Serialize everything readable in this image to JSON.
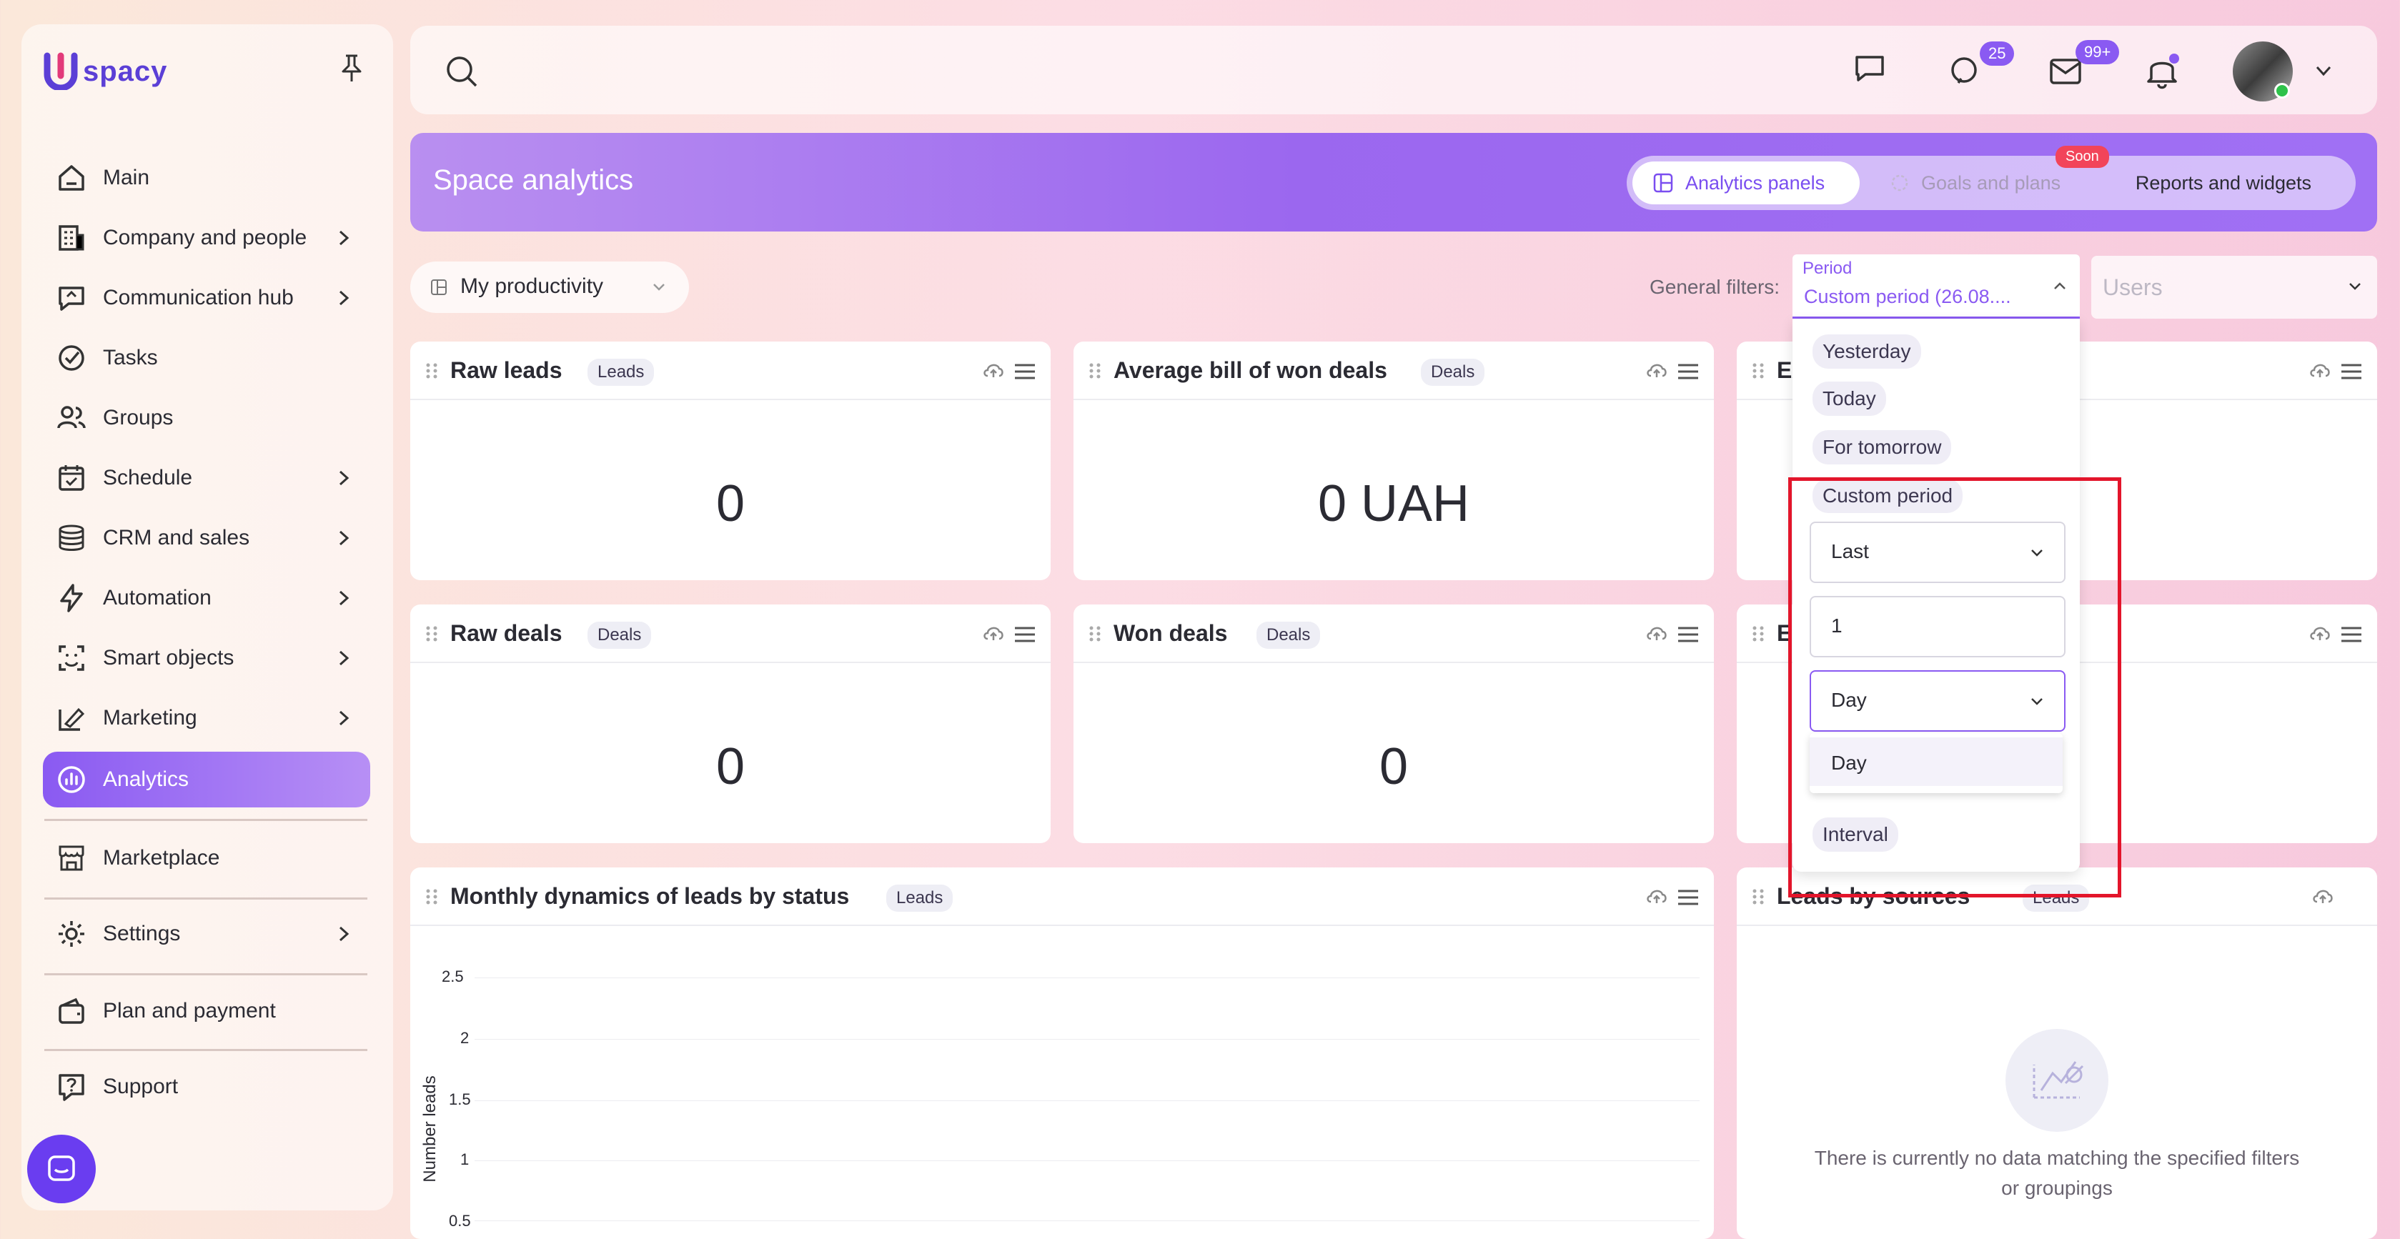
{
  "app": {
    "logo_text": "spacy"
  },
  "sidebar": {
    "items": [
      {
        "label": "Main",
        "icon": "home-icon",
        "chevron": false
      },
      {
        "label": "Company and people",
        "icon": "building-icon",
        "chevron": true
      },
      {
        "label": "Communication hub",
        "icon": "chat-icon",
        "chevron": true
      },
      {
        "label": "Tasks",
        "icon": "check-circle-icon",
        "chevron": false
      },
      {
        "label": "Groups",
        "icon": "users-icon",
        "chevron": false
      },
      {
        "label": "Schedule",
        "icon": "calendar-icon",
        "chevron": true
      },
      {
        "label": "CRM and sales",
        "icon": "coins-icon",
        "chevron": true
      },
      {
        "label": "Automation",
        "icon": "lightning-icon",
        "chevron": true
      },
      {
        "label": "Smart objects",
        "icon": "scan-icon",
        "chevron": true
      },
      {
        "label": "Marketing",
        "icon": "megaphone-icon",
        "chevron": true
      },
      {
        "label": "Analytics",
        "icon": "chart-icon",
        "chevron": false
      },
      {
        "label": "Marketplace",
        "icon": "store-icon",
        "chevron": false
      },
      {
        "label": "Settings",
        "icon": "gear-icon",
        "chevron": true
      },
      {
        "label": "Plan and payment",
        "icon": "wallet-icon",
        "chevron": false
      },
      {
        "label": "Support",
        "icon": "help-icon",
        "chevron": false
      }
    ]
  },
  "topbar": {
    "chat_badge": "25",
    "mail_badge": "99+"
  },
  "header": {
    "title": "Space analytics",
    "tabs": [
      {
        "label": "Analytics panels"
      },
      {
        "label": "Goals and plans"
      },
      {
        "label": "Reports and widgets"
      }
    ],
    "soon_label": "Soon"
  },
  "filters": {
    "dashboard_select": "My productivity",
    "general_label": "General filters:",
    "period_label": "Period",
    "period_value": "Custom period (26.08....",
    "users_placeholder": "Users"
  },
  "period_dropdown": {
    "options": [
      "Yesterday",
      "Today",
      "For tomorrow"
    ],
    "custom_label": "Custom period",
    "last_select": "Last",
    "number_value": "1",
    "unit_select": "Day",
    "unit_options": [
      "Day"
    ],
    "interval_label": "Interval"
  },
  "cards": {
    "raw_leads": {
      "title": "Raw leads",
      "tag": "Leads",
      "value": "0"
    },
    "avg_bill": {
      "title": "Average bill of won deals",
      "tag": "Deals",
      "value": "0 UAH"
    },
    "card3": {
      "title": "Ex"
    },
    "raw_deals": {
      "title": "Raw deals",
      "tag": "Deals",
      "value": "0"
    },
    "won_deals": {
      "title": "Won deals",
      "tag": "Deals",
      "value": "0"
    },
    "card6": {
      "title": "E"
    },
    "monthly": {
      "title": "Monthly dynamics of leads by status",
      "tag": "Leads",
      "ylabel": "Number leads"
    },
    "sources": {
      "title": "Leads by sources",
      "tag": "Leads",
      "empty_text": "There is currently no data matching the specified filters or groupings"
    }
  },
  "chart_data": {
    "type": "line",
    "title": "Monthly dynamics of leads by status",
    "xlabel": "",
    "ylabel": "Number leads",
    "y_ticks": [
      "2.5",
      "2",
      "1.5",
      "1",
      "0.5"
    ],
    "ylim": [
      0.5,
      2.5
    ],
    "grid": true,
    "series": []
  },
  "colors": {
    "accent": "#8a5af2",
    "highlight_box": "#e3152b"
  }
}
